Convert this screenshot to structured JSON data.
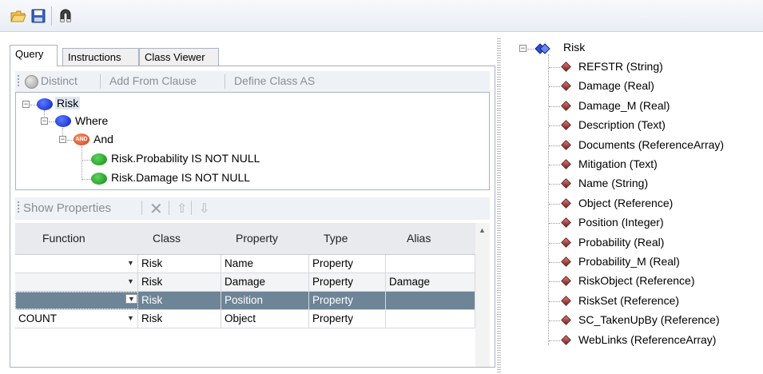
{
  "toolbar": {
    "buttons": [
      "open-folder-icon",
      "save-icon",
      "magnet-icon"
    ]
  },
  "tabs": [
    "Query",
    "Instructions",
    "Class Viewer"
  ],
  "query_toolbar": {
    "distinct": "Distinct",
    "add_from": "Add From Clause",
    "define_class": "Define Class AS"
  },
  "query_tree": {
    "root": "Risk",
    "where": "Where",
    "and_badge": "AND",
    "and": "And",
    "conditions": [
      "Risk.Probability IS NOT NULL",
      "Risk.Damage IS NOT NULL"
    ]
  },
  "props_toolbar": {
    "show_properties": "Show Properties"
  },
  "grid": {
    "columns": [
      "Function",
      "Class",
      "Property",
      "Type",
      "Alias"
    ],
    "rows": [
      {
        "function": "",
        "class": "Risk",
        "property": "Name",
        "type": "Property",
        "alias": ""
      },
      {
        "function": "",
        "class": "Risk",
        "property": "Damage",
        "type": "Property",
        "alias": "Damage"
      },
      {
        "function": "",
        "class": "Risk",
        "property": "Position",
        "type": "Property",
        "alias": ""
      },
      {
        "function": "COUNT",
        "class": "Risk",
        "property": "Object",
        "type": "Property",
        "alias": ""
      }
    ],
    "selected_row": 2
  },
  "class_tree": {
    "root": "Risk",
    "members": [
      "REFSTR (String)",
      "Damage (Real)",
      "Damage_M (Real)",
      "Description (Text)",
      "Documents (ReferenceArray)",
      "Mitigation (Text)",
      "Name (String)",
      "Object (Reference)",
      "Position (Integer)",
      "Probability (Real)",
      "Probability_M (Real)",
      "RiskObject (Reference)",
      "RiskSet (Reference)",
      "SC_TakenUpBy (Reference)",
      "WebLinks (ReferenceArray)"
    ]
  },
  "colors": {
    "selected_row": "#6e8497",
    "class_node": "#1f3fe0",
    "condition_node": "#1e9e1e",
    "and_node": "#e0502a",
    "member_icon": "#8b2b2b"
  }
}
